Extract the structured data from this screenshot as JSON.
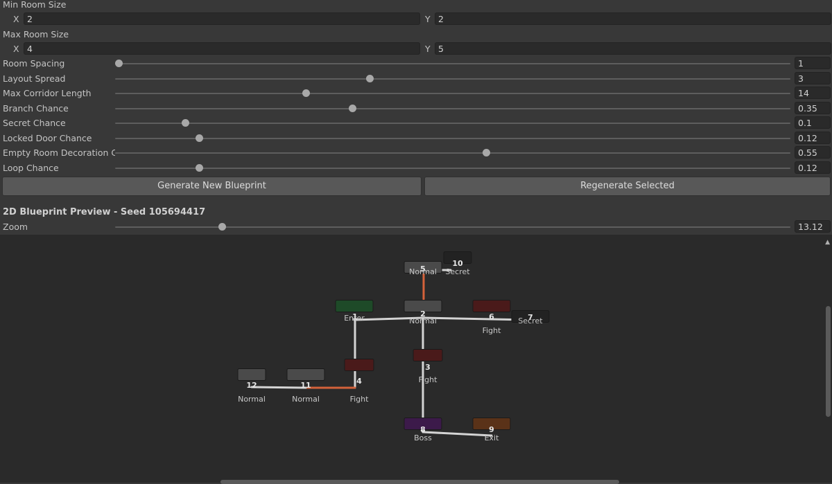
{
  "min_room_size": {
    "label": "Min Room Size",
    "x_label": "X",
    "x": "2",
    "y_label": "Y",
    "y": "2"
  },
  "max_room_size": {
    "label": "Max Room Size",
    "x_label": "X",
    "x": "4",
    "y_label": "Y",
    "y": "5"
  },
  "sliders": [
    {
      "label": "Room Spacing",
      "value": "1",
      "fraction": 0.0
    },
    {
      "label": "Layout Spread",
      "value": "3",
      "fraction": 0.375
    },
    {
      "label": "Max Corridor Length",
      "value": "14",
      "fraction": 0.28
    },
    {
      "label": "Branch Chance",
      "value": "0.35",
      "fraction": 0.35
    },
    {
      "label": "Secret Chance",
      "value": "0.1",
      "fraction": 0.1
    },
    {
      "label": "Locked Door Chance",
      "value": "0.12",
      "fraction": 0.12
    },
    {
      "label": "Empty Room Decoration Ch",
      "value": "0.55",
      "fraction": 0.55
    },
    {
      "label": "Loop Chance",
      "value": "0.12",
      "fraction": 0.12
    }
  ],
  "buttons": {
    "generate": "Generate New Blueprint",
    "regenerate": "Regenerate Selected"
  },
  "preview": {
    "title": "2D Blueprint Preview - Seed 105694417",
    "zoom_label": "Zoom",
    "zoom_value": "13.12",
    "zoom_fraction": 0.155
  },
  "rooms": [
    {
      "id": "1",
      "type": "Enter",
      "color": "#1e4a28"
    },
    {
      "id": "2",
      "type": "Normal",
      "color": "#4a4a4a"
    },
    {
      "id": "3",
      "type": "Fight",
      "color": "#4a1a1a"
    },
    {
      "id": "4",
      "type": "Fight",
      "color": "#4a1a1a"
    },
    {
      "id": "5",
      "type": "Normal",
      "color": "#4a4a4a"
    },
    {
      "id": "6",
      "type": "Fight",
      "color": "#4a1a1a"
    },
    {
      "id": "7",
      "type": "Secret",
      "color": "#222222"
    },
    {
      "id": "8",
      "type": "Boss",
      "color": "#3c1a4a"
    },
    {
      "id": "9",
      "type": "Exit",
      "color": "#5a3218"
    },
    {
      "id": "10",
      "type": "Secret",
      "color": "#222222"
    },
    {
      "id": "11",
      "type": "Normal",
      "color": "#4a4a4a"
    },
    {
      "id": "12",
      "type": "Normal",
      "color": "#4a4a4a"
    }
  ],
  "colors": {
    "corridor": "#d4d4d4",
    "locked_corridor": "#d4623a"
  }
}
